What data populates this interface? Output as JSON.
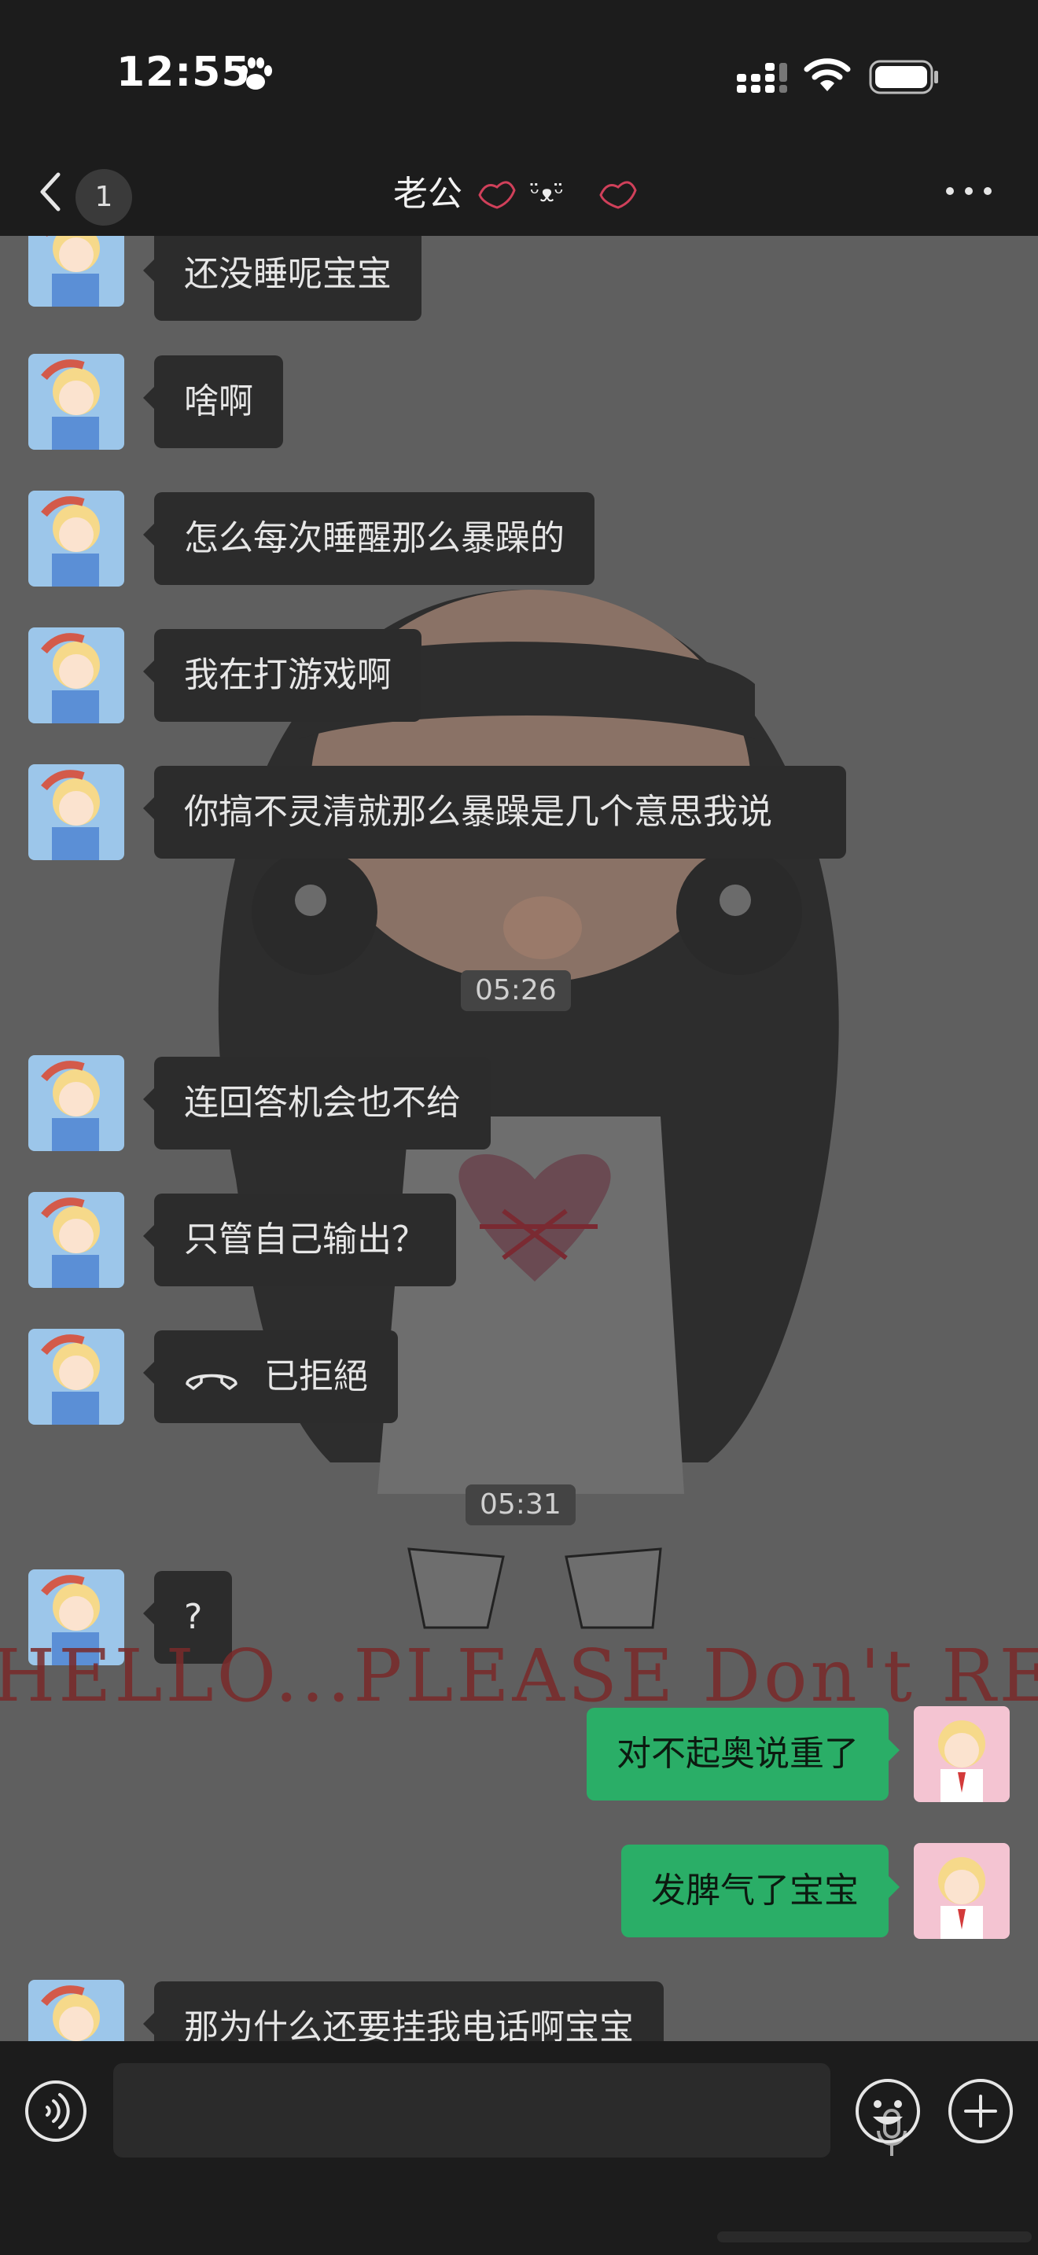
{
  "status_bar": {
    "time": "12:55",
    "icons": [
      "paw-icon",
      "cellular-signal-icon",
      "wifi-icon",
      "battery-icon"
    ]
  },
  "header": {
    "back_icon": "chevron-left-icon",
    "unread_count": "1",
    "title": "老公",
    "more_icon": "more-dots-icon"
  },
  "messages": [
    {
      "side": "in",
      "text": "还没睡呢宝宝"
    },
    {
      "side": "in",
      "text": "啥啊"
    },
    {
      "side": "in",
      "text": "怎么每次睡醒那么暴躁的"
    },
    {
      "side": "in",
      "text": "我在打游戏啊"
    },
    {
      "side": "in",
      "text": "你搞不灵清就那么暴躁是几个意思我说"
    },
    {
      "type": "timestamp",
      "text": "05:26"
    },
    {
      "side": "in",
      "text": "连回答机会也不给"
    },
    {
      "side": "in",
      "text": "只管自己输出？"
    },
    {
      "side": "in",
      "type": "call",
      "text": "已拒絕"
    },
    {
      "type": "timestamp",
      "text": "05:31"
    },
    {
      "side": "in",
      "text": "?"
    },
    {
      "side": "out",
      "text": "对不起奥说重了"
    },
    {
      "side": "out",
      "text": "发脾气了宝宝"
    },
    {
      "side": "in",
      "text": "那为什么还要挂我电话啊宝宝"
    }
  ],
  "wallpaper": {
    "caption": "HELLO...PLEASE Don't REFUSE"
  },
  "input_bar": {
    "voice_icon": "voice-mode-icon",
    "mic_icon": "microphone-icon",
    "emoji_icon": "emoji-icon",
    "plus_icon": "plus-icon"
  },
  "colors": {
    "incoming_bubble": "#2c2c2c",
    "outgoing_bubble": "#2aae67",
    "chat_background": "#5f5f5f",
    "bar_background": "#1c1c1c"
  }
}
